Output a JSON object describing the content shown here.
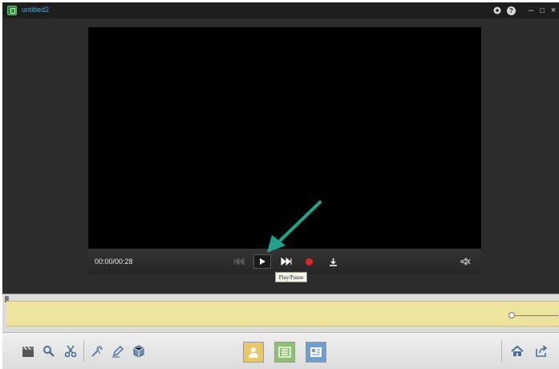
{
  "window": {
    "title": "untitled2",
    "icons": {
      "app": "app-icon",
      "settings": "gear-icon",
      "help": "help-icon",
      "minimize": "minimize-icon",
      "restore": "restore-icon",
      "close": "close-icon"
    },
    "help_glyph": "?",
    "minimize_glyph": "–",
    "restore_glyph": "□",
    "close_glyph": "×"
  },
  "player": {
    "time": "00:00/00:28",
    "tooltip": "Play/Pause",
    "controls": [
      "rewind-icon",
      "play-icon",
      "fast-forward-icon",
      "record-icon",
      "download-icon",
      "no-audio-icon"
    ],
    "record_color": "#e02424"
  },
  "annotation": {
    "arrow_color": "#1fa38c"
  },
  "timeline": {
    "track_color": "#ece49e"
  },
  "toolbar": {
    "left_tools": [
      "clapperboard-icon",
      "magnifier-icon",
      "scissors-icon",
      "magic-wand-icon",
      "pen-icon",
      "3d-cube-icon"
    ],
    "view_modes": [
      "person-view-icon",
      "list-view-icon",
      "card-view-icon"
    ],
    "right_tools": [
      "home-icon",
      "share-icon"
    ]
  }
}
